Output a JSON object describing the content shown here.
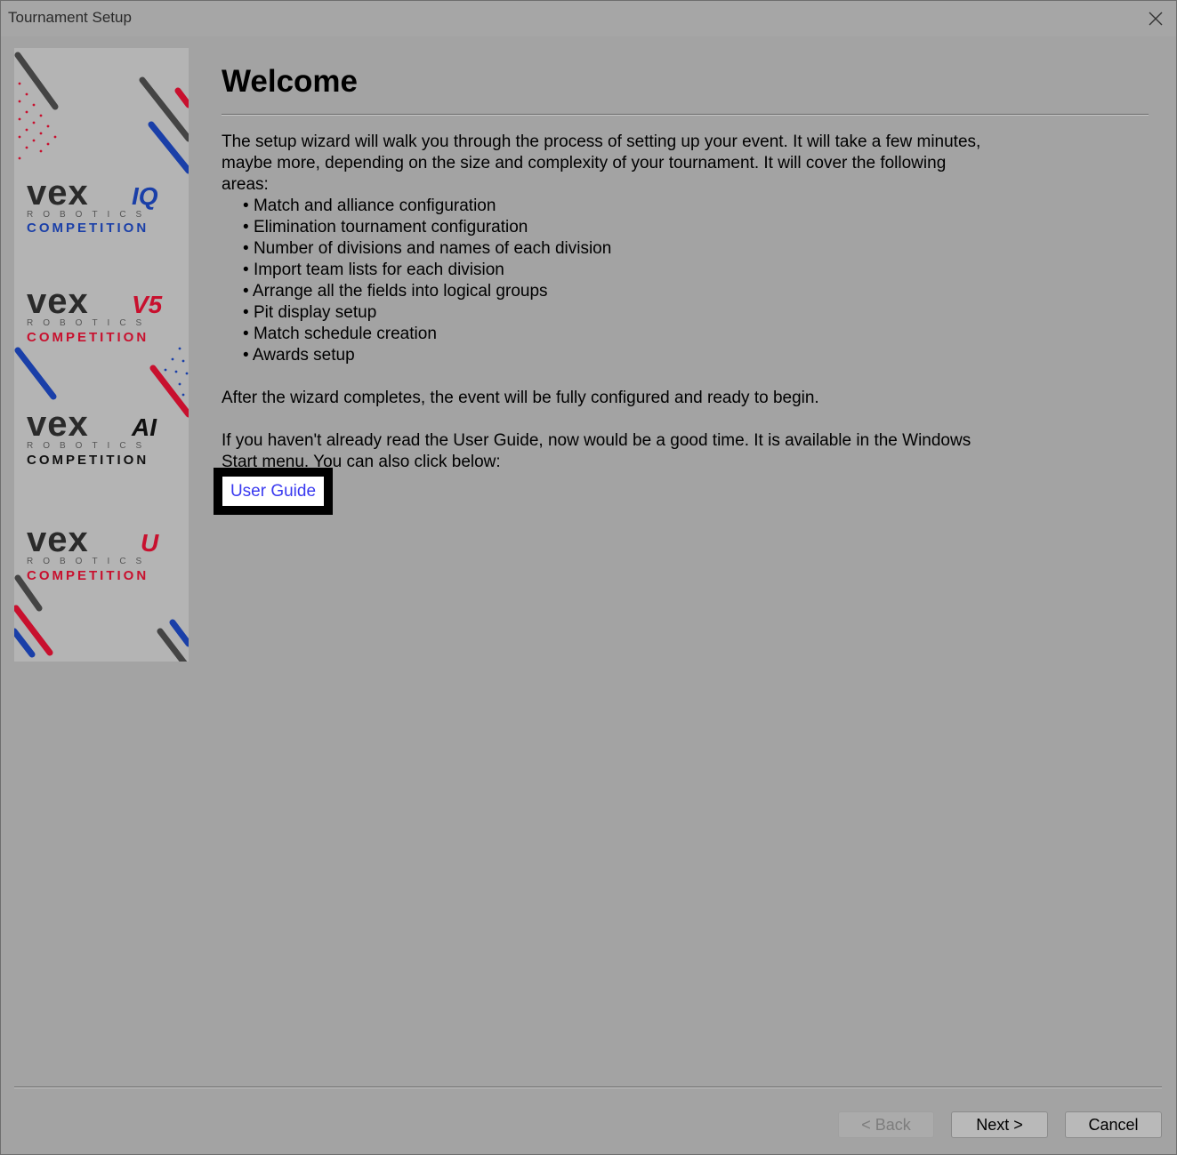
{
  "window": {
    "title": "Tournament Setup"
  },
  "sidebar": {
    "logos": [
      {
        "brand": "vex",
        "program": "IQ",
        "sub1": "ROBOTICS",
        "sub2": "COMPETITION",
        "program_color": "#1a3fa8",
        "competition_color": "#1a3fa8"
      },
      {
        "brand": "vex",
        "program": "V5",
        "sub1": "ROBOTICS",
        "sub2": "COMPETITION",
        "program_color": "#c8102e",
        "competition_color": "#c8102e"
      },
      {
        "brand": "vex",
        "program": "AI",
        "sub1": "ROBOTICS",
        "sub2": "COMPETITION",
        "program_color": "#111111",
        "competition_color": "#111111"
      },
      {
        "brand": "vex",
        "program": "U",
        "sub1": "ROBOTICS",
        "sub2": "COMPETITION",
        "program_color": "#c8102e",
        "competition_color": "#c8102e"
      }
    ]
  },
  "content": {
    "heading": "Welcome",
    "intro_line1": "The setup wizard will walk you through the process of setting up your event.  It will take a few minutes,",
    "intro_line2": "maybe more, depending on the size and complexity of your tournament.  It will cover the following",
    "intro_line3": "areas:",
    "bullets": [
      "Match and alliance configuration",
      "Elimination tournament configuration",
      "Number of divisions and names of each division",
      "Import team lists for each division",
      "Arrange all the fields into logical groups",
      "Pit display setup",
      "Match schedule creation",
      "Awards setup"
    ],
    "after_text": "After the wizard completes, the event will be fully configured and ready to begin.",
    "guide_line1": "If you haven't already read the User Guide, now would be a good time.  It is available in the Windows",
    "guide_line2": "Start menu.  You can also click below:",
    "user_guide_link": "User Guide"
  },
  "buttons": {
    "back": "< Back",
    "next": "Next >",
    "cancel": "Cancel"
  },
  "colors": {
    "background": "#a3a3a3",
    "link": "#3a3af0",
    "accent_red": "#c8102e",
    "accent_blue": "#1a3fa8"
  }
}
